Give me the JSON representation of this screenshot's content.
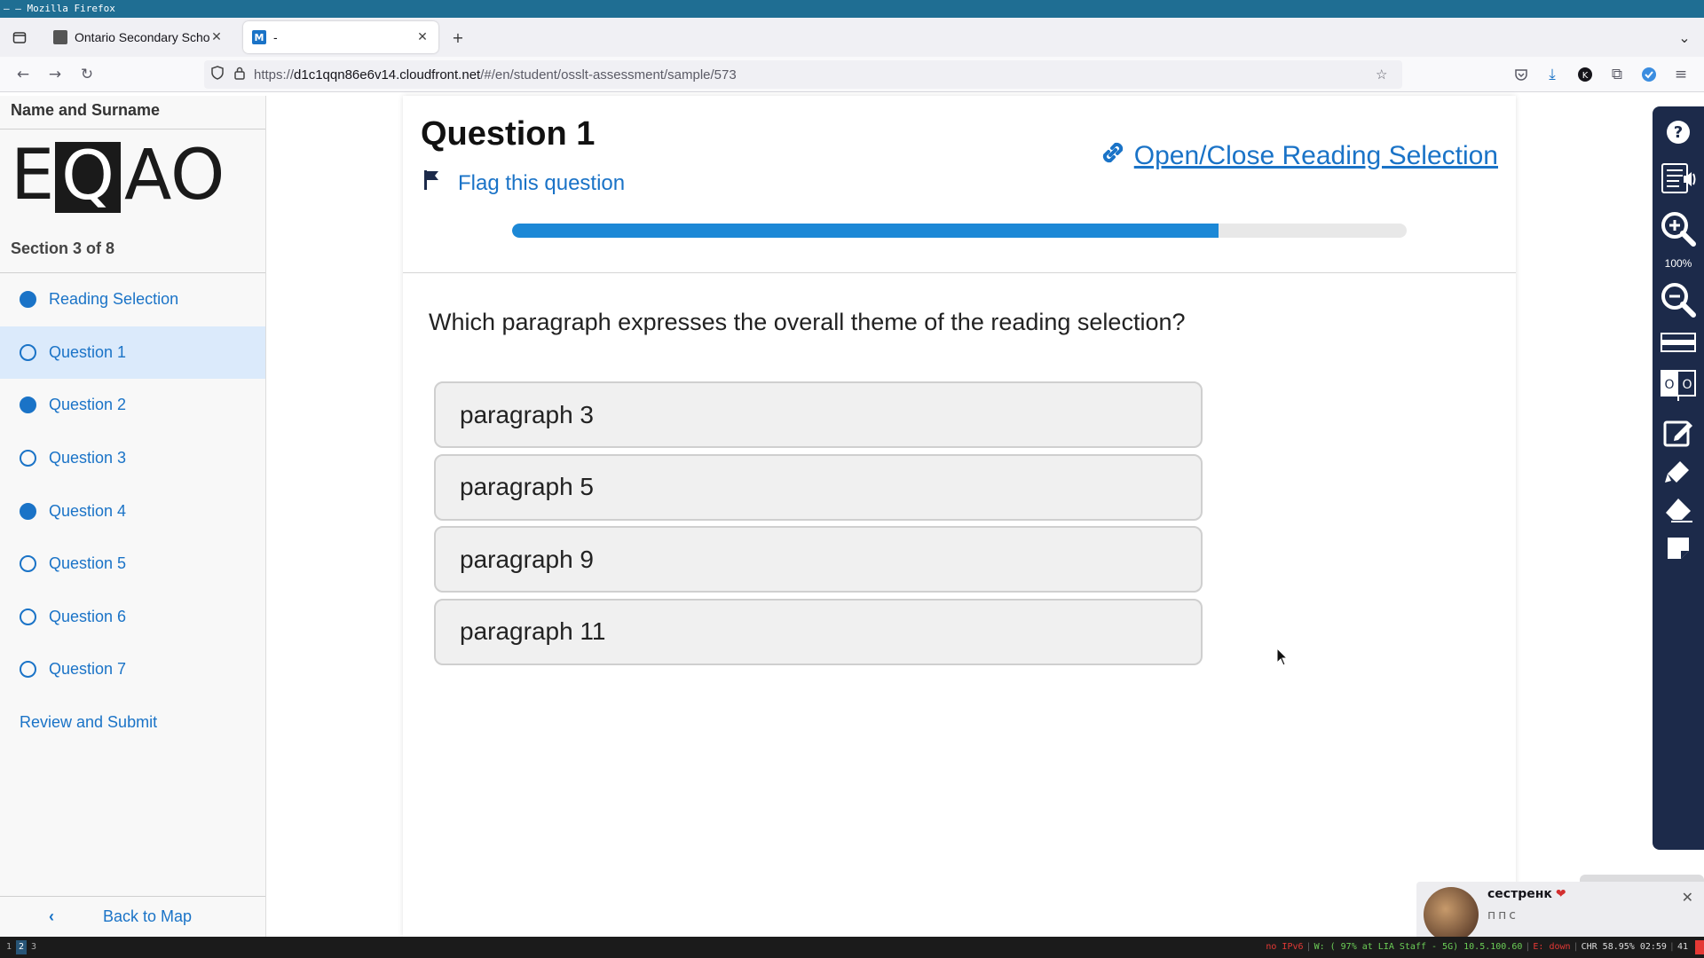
{
  "window": {
    "title": "– – Mozilla Firefox"
  },
  "tabs": [
    {
      "title": "Ontario Secondary School",
      "active": false
    },
    {
      "title": "-",
      "active": true,
      "favicon_letter": "M"
    }
  ],
  "url": {
    "prefix": "https://",
    "host": "d1c1qqn86e6v14.cloudfront.net",
    "path": "/#/en/student/osslt-assessment/sample/573"
  },
  "sidebar": {
    "student_name": "Name and Surname",
    "logo_text": "EQAO",
    "section": "Section 3 of 8",
    "items": [
      {
        "label": "Reading Selection",
        "filled": true,
        "current": false
      },
      {
        "label": "Question 1",
        "filled": false,
        "current": true
      },
      {
        "label": "Question 2",
        "filled": true,
        "current": false
      },
      {
        "label": "Question 3",
        "filled": false,
        "current": false
      },
      {
        "label": "Question 4",
        "filled": true,
        "current": false
      },
      {
        "label": "Question 5",
        "filled": false,
        "current": false
      },
      {
        "label": "Question 6",
        "filled": false,
        "current": false
      },
      {
        "label": "Question 7",
        "filled": false,
        "current": false
      }
    ],
    "review_label": "Review and Submit",
    "back_label": "Back to Map"
  },
  "question": {
    "title": "Question 1",
    "flag_label": "Flag this question",
    "reading_toggle_label": "Open/Close Reading Selection",
    "progress_fraction": 0.79,
    "prompt": "Which paragraph expresses the overall theme of the reading selection?",
    "options": [
      "paragraph 3",
      "paragraph 5",
      "paragraph 9",
      "paragraph 11"
    ]
  },
  "toolbar": {
    "zoom_level": "100%",
    "tools": [
      "help-icon",
      "text-to-speech-icon",
      "zoom-in-icon",
      "zoom-out-icon",
      "line-reader-icon",
      "hi-contrast-icon",
      "notepad-icon",
      "highlighter-icon",
      "eraser-icon",
      "sticky-note-icon"
    ]
  },
  "notification": {
    "sender": "сестренк",
    "message": "ппс"
  },
  "statusbar": {
    "workspaces": [
      "1",
      "2",
      "3"
    ],
    "active_workspace": "2",
    "ipv6": "no IPv6",
    "wifi": "W: ( 97% at LIA Staff - 5G) 10.5.100.60",
    "ethernet": "E: down",
    "battery": "CHR 58.95% 02:59",
    "extra": "41"
  },
  "colors": {
    "accent": "#1a73c7",
    "progress": "#1c88d6",
    "toolbar_bg": "#1c2a4a",
    "titlebar_bg": "#1f6e93"
  }
}
